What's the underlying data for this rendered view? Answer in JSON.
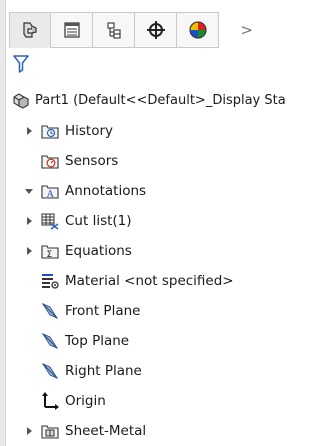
{
  "tabs": [
    {
      "name": "feature-manager-tab",
      "icon": "feature-tree-icon",
      "active": true
    },
    {
      "name": "property-manager-tab",
      "icon": "property-list-icon",
      "active": false
    },
    {
      "name": "configuration-manager-tab",
      "icon": "configuration-icon",
      "active": false
    },
    {
      "name": "dimxpert-manager-tab",
      "icon": "crosshair-icon",
      "active": false
    },
    {
      "name": "display-manager-tab",
      "icon": "color-wheel-icon",
      "active": false
    }
  ],
  "tab_more_label": ">",
  "tree": {
    "root": {
      "label": "Part1  (Default<<Default>_Display Sta",
      "icon": "part-icon"
    },
    "items": [
      {
        "label": "History",
        "icon": "history-folder-icon",
        "expander": "collapsed"
      },
      {
        "label": "Sensors",
        "icon": "sensors-folder-icon",
        "expander": "none"
      },
      {
        "label": "Annotations",
        "icon": "annotations-folder-icon",
        "expander": "expanded"
      },
      {
        "label": "Cut list(1)",
        "icon": "cut-list-icon",
        "expander": "collapsed"
      },
      {
        "label": "Equations",
        "icon": "equations-folder-icon",
        "expander": "collapsed"
      },
      {
        "label": "Material <not specified>",
        "icon": "material-icon",
        "expander": "none"
      },
      {
        "label": "Front Plane",
        "icon": "plane-icon",
        "expander": "none"
      },
      {
        "label": "Top Plane",
        "icon": "plane-icon",
        "expander": "none"
      },
      {
        "label": "Right Plane",
        "icon": "plane-icon",
        "expander": "none"
      },
      {
        "label": "Origin",
        "icon": "origin-icon",
        "expander": "none"
      },
      {
        "label": "Sheet-Metal",
        "icon": "sheet-metal-icon",
        "expander": "collapsed"
      }
    ]
  }
}
